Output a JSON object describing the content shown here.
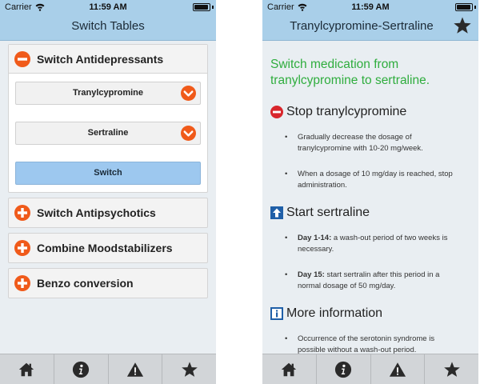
{
  "status_bar": {
    "carrier": "Carrier",
    "time": "11:59 AM",
    "battery_level": 0.85
  },
  "left_screen": {
    "title": "Switch Tables",
    "sections": [
      {
        "label": "Switch Antidepressants",
        "state": "expanded",
        "icon": "minus-circle-icon"
      },
      {
        "label": "Switch Antipsychotics",
        "state": "collapsed",
        "icon": "plus-circle-icon"
      },
      {
        "label": "Combine Moodstabilizers",
        "state": "collapsed",
        "icon": "plus-circle-icon"
      },
      {
        "label": "Benzo conversion",
        "state": "collapsed",
        "icon": "plus-circle-icon"
      }
    ],
    "from_select": "Tranylcypromine",
    "to_select": "Sertraline",
    "switch_button": "Switch"
  },
  "right_screen": {
    "title": "Tranylcypromine-Sertraline",
    "headline": "Switch medication from tranylcypromine to sertraline.",
    "stop": {
      "title": "Stop tranylcypromine",
      "icon": "no-entry-icon",
      "items": [
        "Gradually decrease the dosage of tranylcypromine with 10-20 mg/week.",
        "When a dosage of 10 mg/day is reached, stop administration."
      ]
    },
    "start": {
      "title": "Start sertraline",
      "icon": "up-arrow-box-icon",
      "items": [
        {
          "label": "Day 1-14:",
          "text": " a wash-out period of two weeks is necessary."
        },
        {
          "label": "Day 15:",
          "text": " start sertralin after this period in a normal dosage of 50 mg/day."
        }
      ]
    },
    "info": {
      "title": "More information",
      "icon": "info-box-icon",
      "items": [
        "Occurrence of the serotonin syndrome is possible without a wash-out period."
      ]
    }
  },
  "tab_bar": [
    "home-icon",
    "info-icon",
    "warning-icon",
    "star-icon"
  ],
  "colors": {
    "nav_bar": "#a9cfe9",
    "accent_orange": "#f05a1a",
    "headline_green": "#2fad3e",
    "switch_button": "#9dc8ef"
  }
}
